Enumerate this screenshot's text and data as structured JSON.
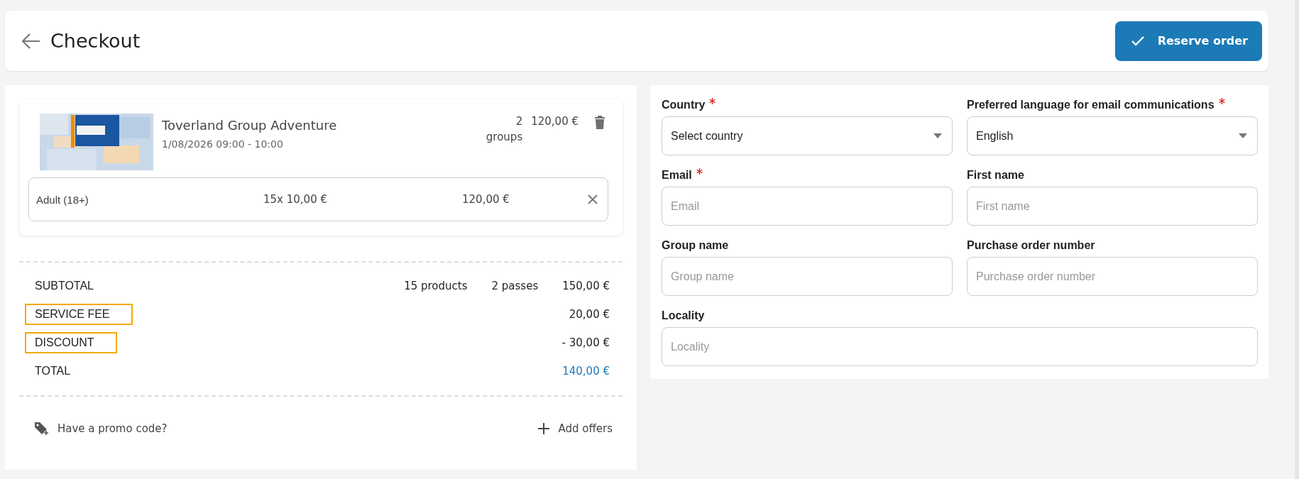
{
  "header": {
    "title": "Checkout",
    "action": "Reserve order"
  },
  "cart": {
    "items": [
      {
        "kind": "picture",
        "title": "Toverland Group Adventure",
        "datetime": "1/08/2026 09:00 - 10:00",
        "quantity": "2",
        "unit": "groups",
        "price": "120,00 €",
        "tickets": [
          {
            "name": "Adult (18+)",
            "quantity": "15x 10,00 €",
            "total": "120,00 €"
          }
        ]
      }
    ]
  },
  "summary": [
    {
      "label": "SUBTOTAL",
      "products": "15 products",
      "passes": "2 passes",
      "amount": "150,00 €",
      "highlighted": false,
      "kind": "normal"
    },
    {
      "label": "SERVICE FEE",
      "amount": "20,00 €",
      "highlighted": true,
      "kind": "normal"
    },
    {
      "label": "DISCOUNT",
      "amount": "- 30,00 €",
      "highlighted": true,
      "kind": "normal"
    },
    {
      "label": "TOTAL",
      "amount": "140,00 €",
      "highlighted": false,
      "kind": "total"
    }
  ],
  "footer": {
    "promo": "Have a promo code?",
    "offers": "Add offers"
  },
  "form": {
    "fields": [
      {
        "kind": "select",
        "label": "Country",
        "required": true,
        "value": "Select country"
      },
      {
        "kind": "select",
        "label": "Preferred language for email communications",
        "required": true,
        "value": "English"
      },
      {
        "kind": "text",
        "label": "Email",
        "required": true,
        "placeholder": "Email"
      },
      {
        "kind": "text",
        "label": "First name",
        "required": false,
        "placeholder": "First name"
      },
      {
        "kind": "text",
        "label": "Group name",
        "required": false,
        "placeholder": "Group name"
      },
      {
        "kind": "text",
        "label": "Purchase order number",
        "required": false,
        "placeholder": "Purchase order number"
      },
      {
        "kind": "wide_text",
        "label": "Locality",
        "required": false,
        "placeholder": "Locality"
      }
    ]
  }
}
